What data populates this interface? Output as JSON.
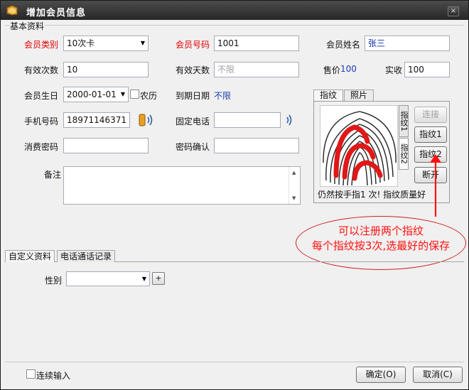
{
  "window": {
    "title": "增加会员信息",
    "close_glyph": "×"
  },
  "basic_group": {
    "title": "基本资料"
  },
  "form": {
    "member_type_label": "会员类别",
    "member_type_value": "10次卡",
    "member_no_label": "会员号码",
    "member_no_value": "1001",
    "member_name_label": "会员姓名",
    "member_name_value": "张三",
    "valid_times_label": "有效次数",
    "valid_times_value": "10",
    "valid_days_label": "有效天数",
    "valid_days_value": "不限",
    "price_label": "售价",
    "price_value": "100",
    "received_label": "实收",
    "received_value": "100",
    "birthday_label": "会员生日",
    "birthday_value": "2000-01-01",
    "lunar_label": "农历",
    "expire_label": "到期日期",
    "expire_value": "不限",
    "mobile_label": "手机号码",
    "mobile_value": "18971146371",
    "phone_label": "固定电话",
    "phone_value": "",
    "password_label": "消费密码",
    "password_value": "",
    "password_confirm_label": "密码确认",
    "password_confirm_value": "",
    "notes_label": "备注",
    "notes_value": ""
  },
  "right_tabs": {
    "fingerprint": "指纹",
    "photo": "照片"
  },
  "fingerprint": {
    "vtab1": "指纹1",
    "vtab2": "指纹2",
    "connect_button": "连接",
    "fp1_button": "指纹1",
    "fp2_button": "指纹2",
    "disconnect_button": "断开",
    "status": "仍然按手指1  次! 指纹质量好"
  },
  "annotation": {
    "line1": "可以注册两个指纹",
    "line2": "每个指纹按3次,选最好的保存"
  },
  "lower_tabs": {
    "custom": "自定义资料",
    "calls": "电话通话记录"
  },
  "custom": {
    "gender_label": "性别",
    "gender_value": "",
    "plus_label": "+"
  },
  "footer": {
    "continuous_label": "连续输入",
    "ok_button": "确定(O)",
    "cancel_button": "取消(C)"
  },
  "colors": {
    "required_label": "#e60000",
    "value_blue": "#1a3fb4",
    "annotation_red": "#ff1010"
  },
  "icons": {
    "app": "app-book-icon",
    "phone": "phone-handset-icon",
    "close": "close-icon",
    "dropdown": "chevron-down-icon"
  }
}
